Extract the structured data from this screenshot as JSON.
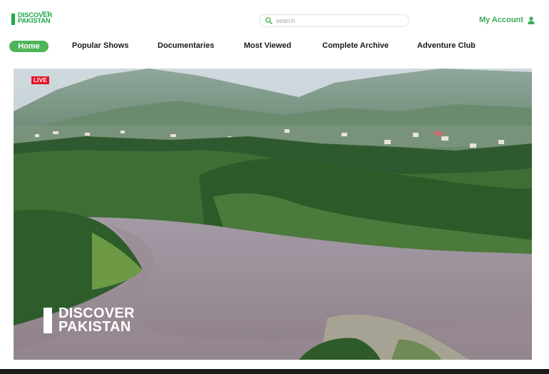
{
  "brand": {
    "line1": "DISCOVER",
    "line2": "PAKISTAN",
    "tag": "HD TV",
    "color": "#1fa84a"
  },
  "search": {
    "placeholder": "search",
    "icon": "search-icon"
  },
  "account": {
    "label": "My Account",
    "icon": "user-icon"
  },
  "nav": {
    "home": "Home",
    "items": [
      "Popular Shows",
      "Documentaries",
      "Most Viewed",
      "Complete Archive",
      "Adventure Club"
    ]
  },
  "video": {
    "live_badge": "LIVE",
    "watermark_line1": "DISCOVER",
    "watermark_line2": "PAKISTAN"
  },
  "colors": {
    "accent": "#4cb558",
    "live": "#e3142a"
  }
}
